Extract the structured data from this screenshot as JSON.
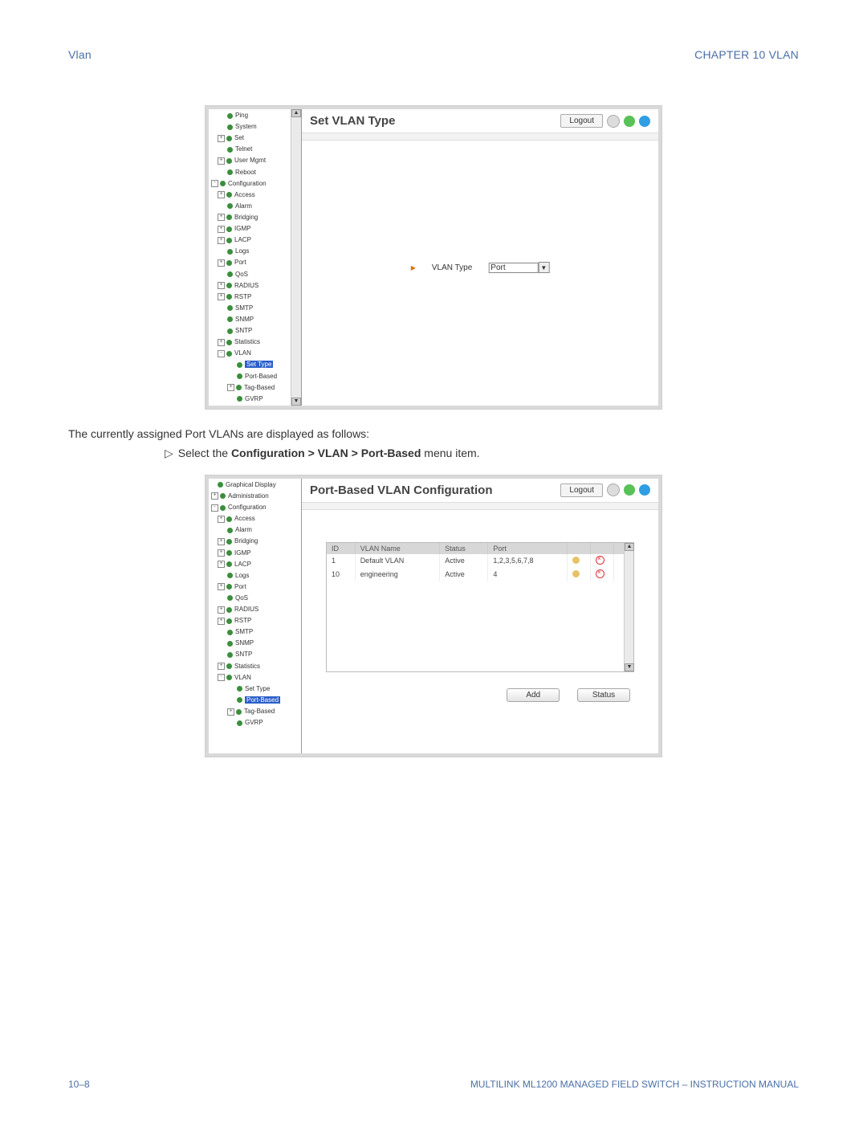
{
  "header": {
    "left": "Vlan",
    "right": "CHAPTER 10  VLAN"
  },
  "screenshot1": {
    "title": "Set VLAN Type",
    "logout": "Logout",
    "tree": [
      {
        "level": 3,
        "exp": "",
        "label": "Ping"
      },
      {
        "level": 3,
        "exp": "",
        "label": "System"
      },
      {
        "level": 2,
        "exp": "+",
        "label": "Set"
      },
      {
        "level": 3,
        "exp": "",
        "label": "Telnet"
      },
      {
        "level": 2,
        "exp": "+",
        "label": "User Mgmt"
      },
      {
        "level": 3,
        "exp": "",
        "label": "Reboot"
      },
      {
        "level": 1,
        "exp": "-",
        "label": "Configuration"
      },
      {
        "level": 2,
        "exp": "+",
        "label": "Access"
      },
      {
        "level": 3,
        "exp": "",
        "label": "Alarm"
      },
      {
        "level": 2,
        "exp": "+",
        "label": "Bridging"
      },
      {
        "level": 2,
        "exp": "+",
        "label": "IGMP"
      },
      {
        "level": 2,
        "exp": "+",
        "label": "LACP"
      },
      {
        "level": 3,
        "exp": "",
        "label": "Logs"
      },
      {
        "level": 2,
        "exp": "+",
        "label": "Port"
      },
      {
        "level": 3,
        "exp": "",
        "label": "QoS"
      },
      {
        "level": 2,
        "exp": "+",
        "label": "RADIUS"
      },
      {
        "level": 2,
        "exp": "+",
        "label": "RSTP"
      },
      {
        "level": 3,
        "exp": "",
        "label": "SMTP"
      },
      {
        "level": 3,
        "exp": "",
        "label": "SNMP"
      },
      {
        "level": 3,
        "exp": "",
        "label": "SNTP"
      },
      {
        "level": 2,
        "exp": "+",
        "label": "Statistics"
      },
      {
        "level": 2,
        "exp": "-",
        "label": "VLAN"
      },
      {
        "level": 4,
        "exp": "",
        "label": "Set Type",
        "selected": true
      },
      {
        "level": 4,
        "exp": "",
        "label": "Port-Based"
      },
      {
        "level": 3,
        "exp": "+",
        "label": "Tag-Based"
      },
      {
        "level": 4,
        "exp": "",
        "label": "GVRP"
      }
    ],
    "field_label": "VLAN Type",
    "field_value": "Port"
  },
  "body_text1": "The currently assigned Port VLANs are displayed as follows:",
  "instruction1_prefix": "Select the ",
  "instruction1_bold": "Configuration > VLAN > Port-Based",
  "instruction1_suffix": " menu item.",
  "screenshot2": {
    "title": "Port-Based VLAN Configuration",
    "logout": "Logout",
    "tree": [
      {
        "level": 2,
        "exp": "",
        "label": "Graphical Display"
      },
      {
        "level": 1,
        "exp": "+",
        "label": "Administration"
      },
      {
        "level": 1,
        "exp": "-",
        "label": "Configuration"
      },
      {
        "level": 2,
        "exp": "+",
        "label": "Access"
      },
      {
        "level": 3,
        "exp": "",
        "label": "Alarm"
      },
      {
        "level": 2,
        "exp": "+",
        "label": "Bridging"
      },
      {
        "level": 2,
        "exp": "+",
        "label": "IGMP"
      },
      {
        "level": 2,
        "exp": "+",
        "label": "LACP"
      },
      {
        "level": 3,
        "exp": "",
        "label": "Logs"
      },
      {
        "level": 2,
        "exp": "+",
        "label": "Port"
      },
      {
        "level": 3,
        "exp": "",
        "label": "QoS"
      },
      {
        "level": 2,
        "exp": "+",
        "label": "RADIUS"
      },
      {
        "level": 2,
        "exp": "+",
        "label": "RSTP"
      },
      {
        "level": 3,
        "exp": "",
        "label": "SMTP"
      },
      {
        "level": 3,
        "exp": "",
        "label": "SNMP"
      },
      {
        "level": 3,
        "exp": "",
        "label": "SNTP"
      },
      {
        "level": 2,
        "exp": "+",
        "label": "Statistics"
      },
      {
        "level": 2,
        "exp": "-",
        "label": "VLAN"
      },
      {
        "level": 4,
        "exp": "",
        "label": "Set Type"
      },
      {
        "level": 4,
        "exp": "",
        "label": "Port-Based",
        "selected": true
      },
      {
        "level": 3,
        "exp": "+",
        "label": "Tag-Based"
      },
      {
        "level": 4,
        "exp": "",
        "label": "GVRP"
      }
    ],
    "table": {
      "headers": [
        "ID",
        "VLAN Name",
        "Status",
        "Port"
      ],
      "rows": [
        {
          "id": "1",
          "name": "Default VLAN",
          "status": "Active",
          "port": "1,2,3,5,6,7,8"
        },
        {
          "id": "10",
          "name": "engineering",
          "status": "Active",
          "port": "4"
        }
      ]
    },
    "add_btn": "Add",
    "status_btn": "Status"
  },
  "footer": {
    "left": "10–8",
    "right": "MULTILINK ML1200 MANAGED FIELD SWITCH – INSTRUCTION MANUAL"
  }
}
